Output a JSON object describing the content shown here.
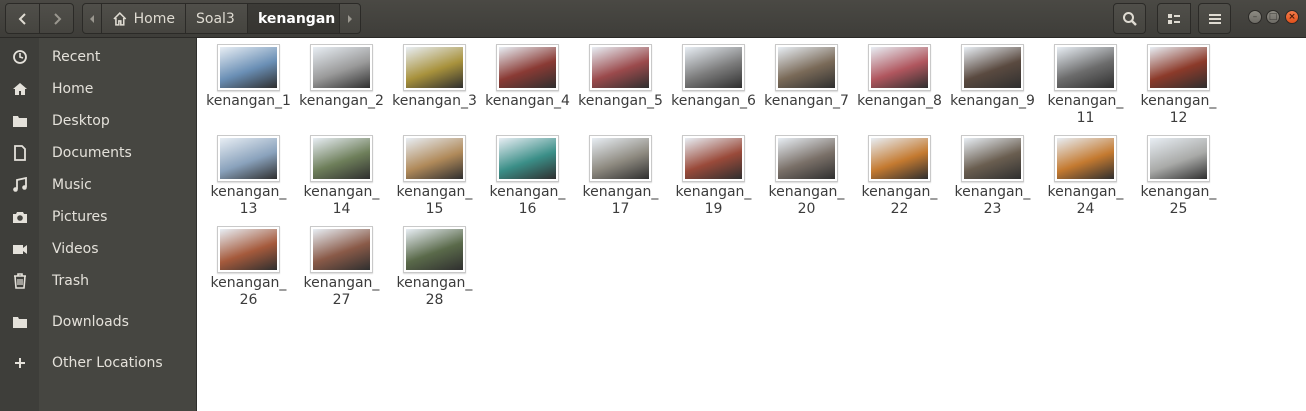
{
  "breadcrumb": {
    "home": "Home",
    "soal3": "Soal3",
    "current": "kenangan"
  },
  "sidebar": {
    "items": [
      {
        "label": "Recent",
        "icon": "clock-icon"
      },
      {
        "label": "Home",
        "icon": "home-icon"
      },
      {
        "label": "Desktop",
        "icon": "folder-icon"
      },
      {
        "label": "Documents",
        "icon": "document-icon"
      },
      {
        "label": "Music",
        "icon": "music-icon"
      },
      {
        "label": "Pictures",
        "icon": "camera-icon"
      },
      {
        "label": "Videos",
        "icon": "video-icon"
      },
      {
        "label": "Trash",
        "icon": "trash-icon"
      },
      {
        "label": "Downloads",
        "icon": "folder-icon"
      },
      {
        "label": "Other Locations",
        "icon": "plus-icon"
      }
    ]
  },
  "files": [
    {
      "l1": "kenangan_1",
      "l2": "",
      "color": "#6a8fb5"
    },
    {
      "l1": "kenangan_2",
      "l2": "",
      "color": "#9a9a9a"
    },
    {
      "l1": "kenangan_3",
      "l2": "",
      "color": "#a8923c"
    },
    {
      "l1": "kenangan_4",
      "l2": "",
      "color": "#8a3a34"
    },
    {
      "l1": "kenangan_5",
      "l2": "",
      "color": "#9b4a4c"
    },
    {
      "l1": "kenangan_6",
      "l2": "",
      "color": "#7c7c7c"
    },
    {
      "l1": "kenangan_7",
      "l2": "",
      "color": "#7a6a58"
    },
    {
      "l1": "kenangan_8",
      "l2": "",
      "color": "#b0565e"
    },
    {
      "l1": "kenangan_9",
      "l2": "",
      "color": "#5a4a40"
    },
    {
      "l1": "kenangan_",
      "l2": "11",
      "color": "#6c6c6c"
    },
    {
      "l1": "kenangan_",
      "l2": "12",
      "color": "#8c3a2a"
    },
    {
      "l1": "kenangan_",
      "l2": "13",
      "color": "#8aa2bc"
    },
    {
      "l1": "kenangan_",
      "l2": "14",
      "color": "#6e7f5a"
    },
    {
      "l1": "kenangan_",
      "l2": "15",
      "color": "#b08a5a"
    },
    {
      "l1": "kenangan_",
      "l2": "16",
      "color": "#3b8f88"
    },
    {
      "l1": "kenangan_",
      "l2": "17",
      "color": "#8e8a80"
    },
    {
      "l1": "kenangan_",
      "l2": "19",
      "color": "#9a4a3a"
    },
    {
      "l1": "kenangan_",
      "l2": "20",
      "color": "#7a7068"
    },
    {
      "l1": "kenangan_",
      "l2": "22",
      "color": "#c47a30"
    },
    {
      "l1": "kenangan_",
      "l2": "23",
      "color": "#6a5e50"
    },
    {
      "l1": "kenangan_",
      "l2": "24",
      "color": "#c47a30"
    },
    {
      "l1": "kenangan_",
      "l2": "25",
      "color": "#a9aaa8"
    },
    {
      "l1": "kenangan_",
      "l2": "26",
      "color": "#a55a3c"
    },
    {
      "l1": "kenangan_",
      "l2": "27",
      "color": "#8a5a48"
    },
    {
      "l1": "kenangan_",
      "l2": "28",
      "color": "#5a6a4a"
    }
  ]
}
